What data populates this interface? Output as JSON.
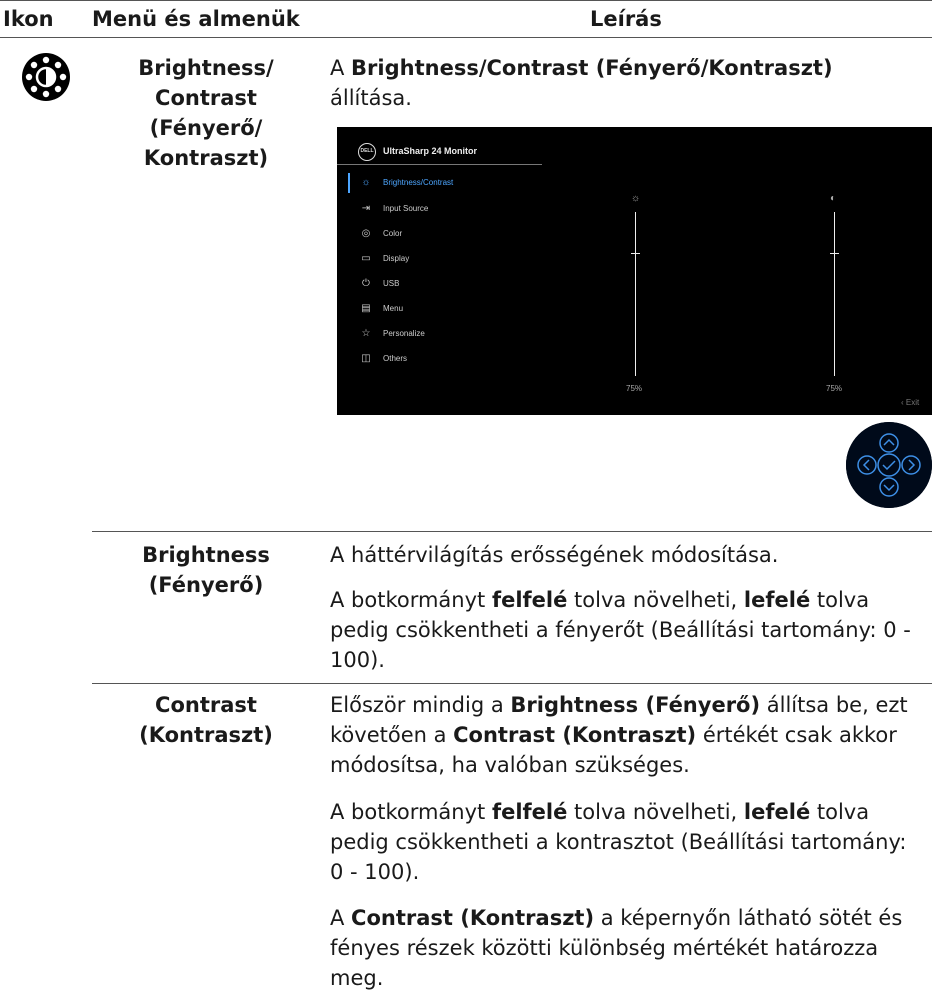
{
  "header": {
    "col1": "Ikon",
    "col2": "Menü és almenük",
    "col3": "Leírás"
  },
  "row1": {
    "icon": "brightness-contrast-icon",
    "menu_lines": [
      "Brightness/",
      "Contrast",
      "(Fényerő/",
      "Kontraszt)"
    ],
    "desc": {
      "prefix": "A ",
      "bold": "Brightness/Contrast (Fényerő/Kontraszt)",
      "suffix": "állítása."
    }
  },
  "osd": {
    "logo": "DELL",
    "title": "UltraSharp 24 Monitor",
    "menu_items": [
      {
        "icon": "sun-icon",
        "label": "Brightness/Contrast",
        "active": true
      },
      {
        "icon": "input-source-icon",
        "label": "Input Source",
        "active": false
      },
      {
        "icon": "color-palette-icon",
        "label": "Color",
        "active": false
      },
      {
        "icon": "display-icon",
        "label": "Display",
        "active": false
      },
      {
        "icon": "usb-icon",
        "label": "USB",
        "active": false
      },
      {
        "icon": "menu-icon",
        "label": "Menu",
        "active": false
      },
      {
        "icon": "star-icon",
        "label": "Personalize",
        "active": false
      },
      {
        "icon": "others-icon",
        "label": "Others",
        "active": false
      }
    ],
    "brightness_value": "75%",
    "contrast_value": "75%",
    "exit_label": "Exit",
    "accent_color": "#4da6ff"
  },
  "row2": {
    "menu_lines": [
      "Brightness",
      "(Fényerő)"
    ],
    "p1": "A háttérvilágítás erősségének módosítása.",
    "p2": {
      "a": "A botkormányt ",
      "b1": "felfelé",
      "c": " tolva növelheti, ",
      "b2": "lefelé",
      "d": " tolva pedig csökkentheti a fényerőt (Beállítási tartomány: 0 - 100)."
    }
  },
  "row3": {
    "menu_lines": [
      "Contrast",
      "(Kontraszt)"
    ],
    "p1": {
      "a": "Először mindig a ",
      "b1": "Brightness (Fényerő)",
      "c": " állítsa be, ezt követően a ",
      "b2": "Contrast (Kontraszt)",
      "d": " értékét csak akkor módosítsa, ha valóban szükséges."
    },
    "p2": {
      "a": "A botkormányt ",
      "b1": "felfelé",
      "c": " tolva növelheti, ",
      "b2": "lefelé",
      "d": " tolva pedig csökkentheti a kontrasztot (Beállítási tartomány: 0 - 100)."
    },
    "p3": {
      "a": "A ",
      "b1": "Contrast (Kontraszt)",
      "d": " a képernyőn látható sötét és fényes részek közötti különbség mértékét határozza meg."
    }
  }
}
